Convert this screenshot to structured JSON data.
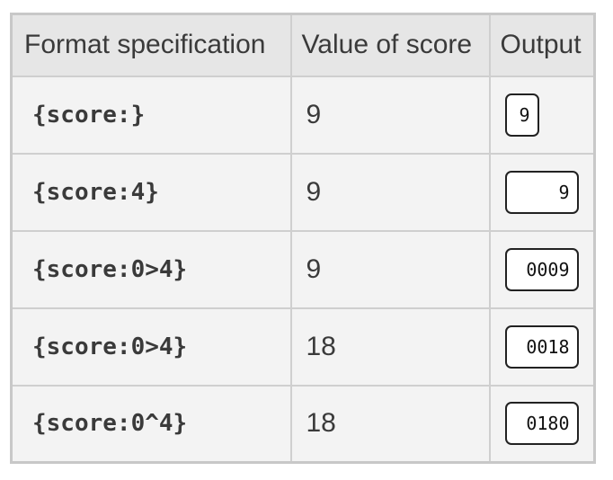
{
  "table": {
    "headers": [
      "Format specification",
      "Value of score",
      "Output"
    ],
    "rows": [
      {
        "spec": "{score:}",
        "value": "9",
        "output": "9"
      },
      {
        "spec": "{score:4}",
        "value": "9",
        "output": "   9"
      },
      {
        "spec": "{score:0>4}",
        "value": "9",
        "output": "0009"
      },
      {
        "spec": "{score:0>4}",
        "value": "18",
        "output": "0018"
      },
      {
        "spec": "{score:0^4}",
        "value": "18",
        "output": "0180"
      }
    ]
  }
}
